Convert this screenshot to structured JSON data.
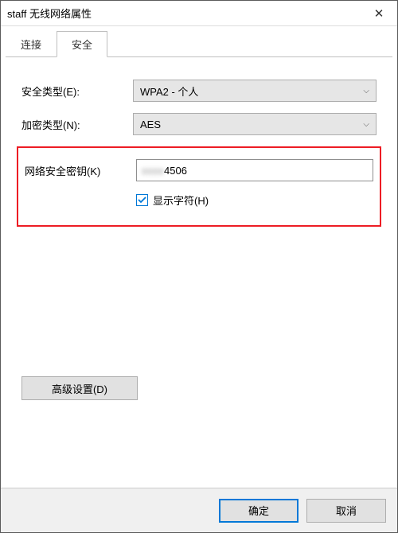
{
  "window": {
    "title": "staff 无线网络属性"
  },
  "tabs": {
    "connect": "连接",
    "security": "安全"
  },
  "fields": {
    "securityTypeLabel": "安全类型(E):",
    "securityTypeValue": "WPA2 - 个人",
    "encryptionTypeLabel": "加密类型(N):",
    "encryptionTypeValue": "AES",
    "networkKeyLabel": "网络安全密钥(K)",
    "networkKeyMasked": "xxxx",
    "networkKeyVisible": "4506",
    "showCharsLabel": "显示字符(H)"
  },
  "buttons": {
    "advanced": "高级设置(D)",
    "ok": "确定",
    "cancel": "取消"
  }
}
